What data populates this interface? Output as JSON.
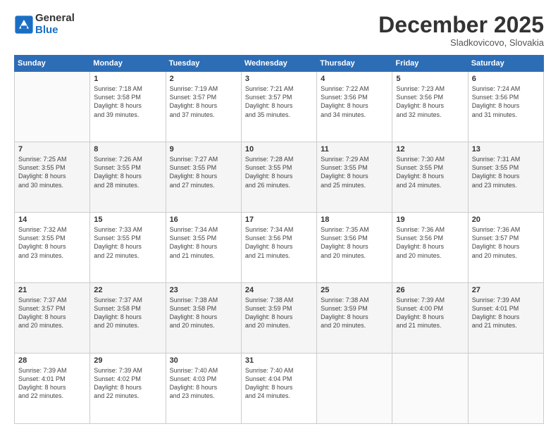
{
  "header": {
    "logo_general": "General",
    "logo_blue": "Blue",
    "month": "December 2025",
    "location": "Sladkovicovo, Slovakia"
  },
  "days_of_week": [
    "Sunday",
    "Monday",
    "Tuesday",
    "Wednesday",
    "Thursday",
    "Friday",
    "Saturday"
  ],
  "weeks": [
    [
      {
        "day": "",
        "info": ""
      },
      {
        "day": "1",
        "info": "Sunrise: 7:18 AM\nSunset: 3:58 PM\nDaylight: 8 hours\nand 39 minutes."
      },
      {
        "day": "2",
        "info": "Sunrise: 7:19 AM\nSunset: 3:57 PM\nDaylight: 8 hours\nand 37 minutes."
      },
      {
        "day": "3",
        "info": "Sunrise: 7:21 AM\nSunset: 3:57 PM\nDaylight: 8 hours\nand 35 minutes."
      },
      {
        "day": "4",
        "info": "Sunrise: 7:22 AM\nSunset: 3:56 PM\nDaylight: 8 hours\nand 34 minutes."
      },
      {
        "day": "5",
        "info": "Sunrise: 7:23 AM\nSunset: 3:56 PM\nDaylight: 8 hours\nand 32 minutes."
      },
      {
        "day": "6",
        "info": "Sunrise: 7:24 AM\nSunset: 3:56 PM\nDaylight: 8 hours\nand 31 minutes."
      }
    ],
    [
      {
        "day": "7",
        "info": "Sunrise: 7:25 AM\nSunset: 3:55 PM\nDaylight: 8 hours\nand 30 minutes."
      },
      {
        "day": "8",
        "info": "Sunrise: 7:26 AM\nSunset: 3:55 PM\nDaylight: 8 hours\nand 28 minutes."
      },
      {
        "day": "9",
        "info": "Sunrise: 7:27 AM\nSunset: 3:55 PM\nDaylight: 8 hours\nand 27 minutes."
      },
      {
        "day": "10",
        "info": "Sunrise: 7:28 AM\nSunset: 3:55 PM\nDaylight: 8 hours\nand 26 minutes."
      },
      {
        "day": "11",
        "info": "Sunrise: 7:29 AM\nSunset: 3:55 PM\nDaylight: 8 hours\nand 25 minutes."
      },
      {
        "day": "12",
        "info": "Sunrise: 7:30 AM\nSunset: 3:55 PM\nDaylight: 8 hours\nand 24 minutes."
      },
      {
        "day": "13",
        "info": "Sunrise: 7:31 AM\nSunset: 3:55 PM\nDaylight: 8 hours\nand 23 minutes."
      }
    ],
    [
      {
        "day": "14",
        "info": "Sunrise: 7:32 AM\nSunset: 3:55 PM\nDaylight: 8 hours\nand 23 minutes."
      },
      {
        "day": "15",
        "info": "Sunrise: 7:33 AM\nSunset: 3:55 PM\nDaylight: 8 hours\nand 22 minutes."
      },
      {
        "day": "16",
        "info": "Sunrise: 7:34 AM\nSunset: 3:55 PM\nDaylight: 8 hours\nand 21 minutes."
      },
      {
        "day": "17",
        "info": "Sunrise: 7:34 AM\nSunset: 3:56 PM\nDaylight: 8 hours\nand 21 minutes."
      },
      {
        "day": "18",
        "info": "Sunrise: 7:35 AM\nSunset: 3:56 PM\nDaylight: 8 hours\nand 20 minutes."
      },
      {
        "day": "19",
        "info": "Sunrise: 7:36 AM\nSunset: 3:56 PM\nDaylight: 8 hours\nand 20 minutes."
      },
      {
        "day": "20",
        "info": "Sunrise: 7:36 AM\nSunset: 3:57 PM\nDaylight: 8 hours\nand 20 minutes."
      }
    ],
    [
      {
        "day": "21",
        "info": "Sunrise: 7:37 AM\nSunset: 3:57 PM\nDaylight: 8 hours\nand 20 minutes."
      },
      {
        "day": "22",
        "info": "Sunrise: 7:37 AM\nSunset: 3:58 PM\nDaylight: 8 hours\nand 20 minutes."
      },
      {
        "day": "23",
        "info": "Sunrise: 7:38 AM\nSunset: 3:58 PM\nDaylight: 8 hours\nand 20 minutes."
      },
      {
        "day": "24",
        "info": "Sunrise: 7:38 AM\nSunset: 3:59 PM\nDaylight: 8 hours\nand 20 minutes."
      },
      {
        "day": "25",
        "info": "Sunrise: 7:38 AM\nSunset: 3:59 PM\nDaylight: 8 hours\nand 20 minutes."
      },
      {
        "day": "26",
        "info": "Sunrise: 7:39 AM\nSunset: 4:00 PM\nDaylight: 8 hours\nand 21 minutes."
      },
      {
        "day": "27",
        "info": "Sunrise: 7:39 AM\nSunset: 4:01 PM\nDaylight: 8 hours\nand 21 minutes."
      }
    ],
    [
      {
        "day": "28",
        "info": "Sunrise: 7:39 AM\nSunset: 4:01 PM\nDaylight: 8 hours\nand 22 minutes."
      },
      {
        "day": "29",
        "info": "Sunrise: 7:39 AM\nSunset: 4:02 PM\nDaylight: 8 hours\nand 22 minutes."
      },
      {
        "day": "30",
        "info": "Sunrise: 7:40 AM\nSunset: 4:03 PM\nDaylight: 8 hours\nand 23 minutes."
      },
      {
        "day": "31",
        "info": "Sunrise: 7:40 AM\nSunset: 4:04 PM\nDaylight: 8 hours\nand 24 minutes."
      },
      {
        "day": "",
        "info": ""
      },
      {
        "day": "",
        "info": ""
      },
      {
        "day": "",
        "info": ""
      }
    ]
  ]
}
